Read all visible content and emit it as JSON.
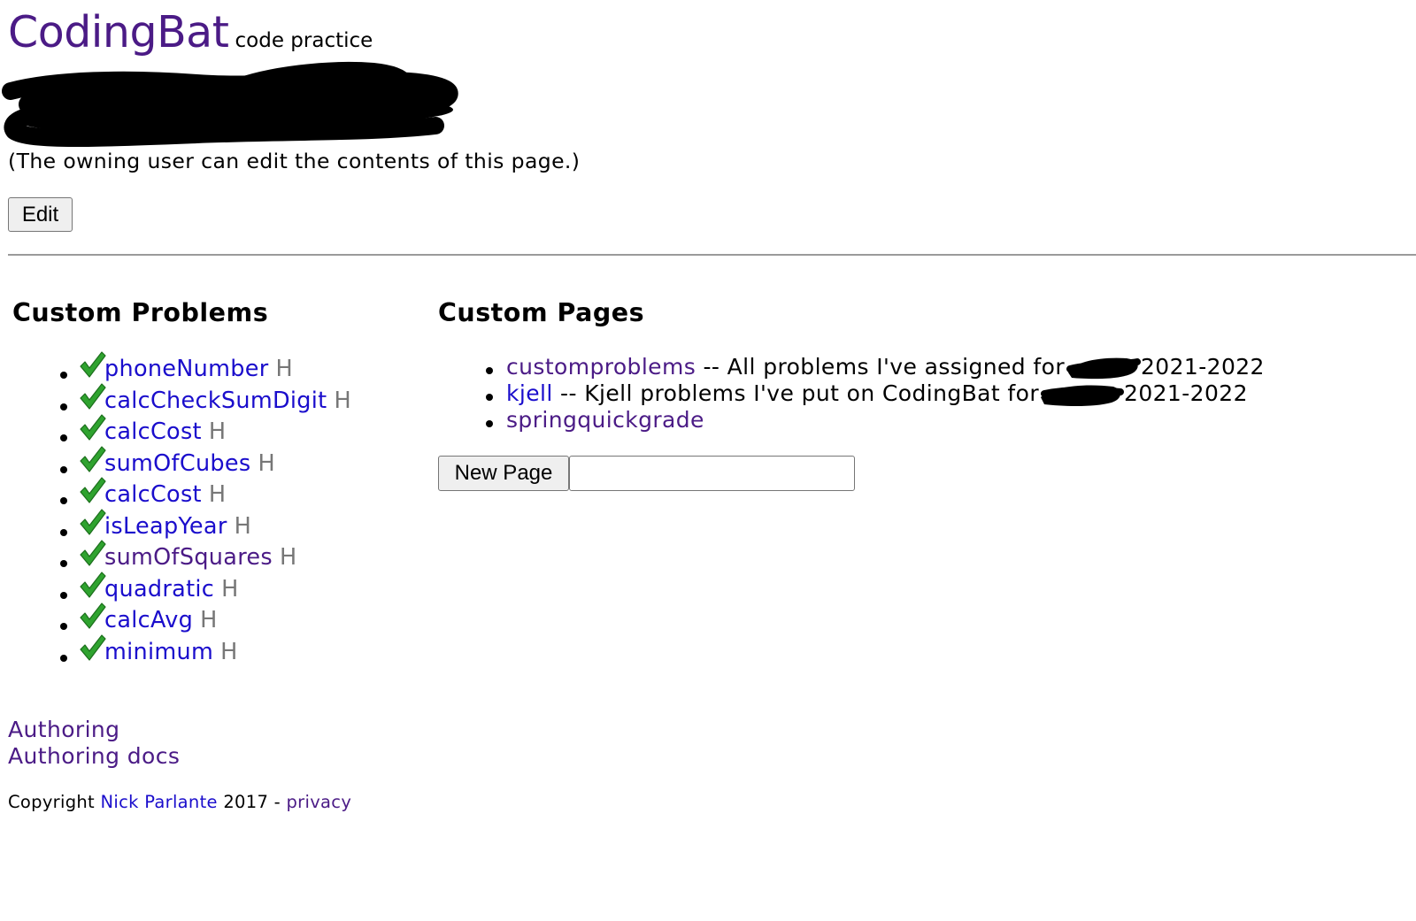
{
  "header": {
    "brand": "CodingBat",
    "tagline": "code practice"
  },
  "owner_note": "(The owning user can edit the contents of this page.)",
  "edit_button": "Edit",
  "custom_problems": {
    "heading": "Custom Problems",
    "items": [
      {
        "name": "phoneNumber",
        "marker": "H",
        "link_color": "#1a0dcc"
      },
      {
        "name": "calcCheckSumDigit",
        "marker": "H",
        "link_color": "#1a0dcc"
      },
      {
        "name": "calcCost",
        "marker": "H",
        "link_color": "#1a0dcc"
      },
      {
        "name": "sumOfCubes",
        "marker": "H",
        "link_color": "#1a0dcc"
      },
      {
        "name": "calcCost",
        "marker": "H",
        "link_color": "#1a0dcc"
      },
      {
        "name": "isLeapYear",
        "marker": "H",
        "link_color": "#1a0dcc"
      },
      {
        "name": "sumOfSquares",
        "marker": "H",
        "link_color": "#4b1b86"
      },
      {
        "name": "quadratic",
        "marker": "H",
        "link_color": "#1a0dcc"
      },
      {
        "name": "calcAvg",
        "marker": "H",
        "link_color": "#1a0dcc"
      },
      {
        "name": "minimum",
        "marker": "H",
        "link_color": "#1a0dcc"
      }
    ]
  },
  "custom_pages": {
    "heading": "Custom Pages",
    "items": [
      {
        "link": "customproblems",
        "desc_before": " -- All problems I've assigned for",
        "desc_after": "2021-2022",
        "link_color": "#4b1b86"
      },
      {
        "link": "kjell",
        "desc_before": " -- Kjell problems I've put on CodingBat for",
        "desc_after": "2021-2022",
        "link_color": "#1a0dcc"
      },
      {
        "link": "springquickgrade",
        "desc_before": "",
        "desc_after": "",
        "link_color": "#4b1b86"
      }
    ],
    "new_page_button": "New Page",
    "new_page_input_value": ""
  },
  "footer": {
    "links": [
      "Authoring",
      "Authoring docs"
    ],
    "copyright_prefix": "Copyright",
    "copyright_author": "Nick Parlante",
    "copyright_year": "2017 -",
    "privacy_link": "privacy"
  },
  "colors": {
    "brand_purple": "#4b1b86",
    "link_blue": "#1a0dcc",
    "check_green": "#2fa32f",
    "marker_gray": "#777777"
  },
  "icons": {
    "check": "check-icon",
    "redaction": "redaction-scribble"
  }
}
